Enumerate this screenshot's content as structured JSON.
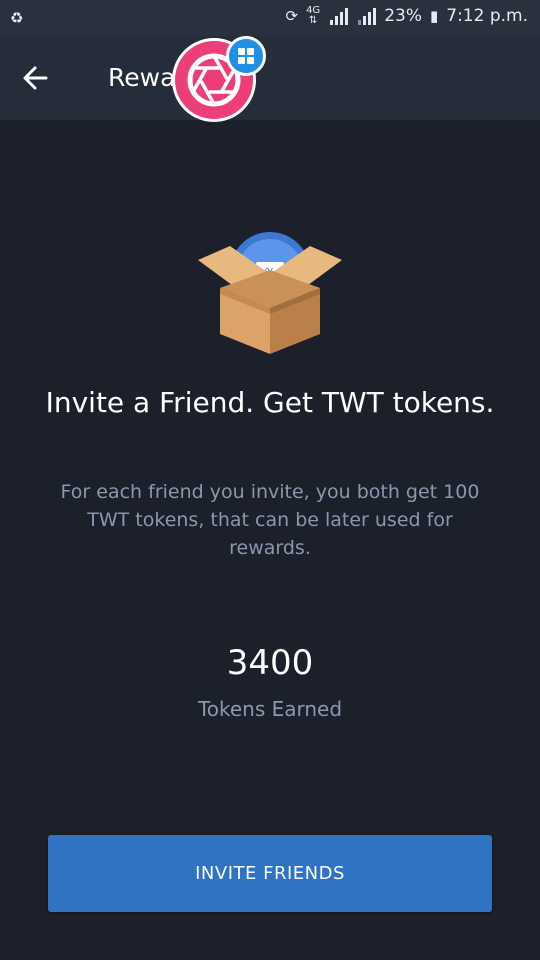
{
  "status_bar": {
    "left_icon": "recycle-icon",
    "network": "4G",
    "battery_percent": "23%",
    "time": "7:12 p.m."
  },
  "app_bar": {
    "back_icon": "arrow-left-icon",
    "title": "Rewa"
  },
  "overlay": {
    "bubble_icon": "camera-aperture-icon",
    "badge_icon": "grid-icon"
  },
  "main": {
    "illustration_icon": "gift-box-coupon-icon",
    "headline": "Invite a Friend. Get TWT tokens.",
    "description": "For each friend you invite, you both get 100 TWT tokens, that can be later used for rewards.",
    "tokens_count": "3400",
    "tokens_label": "Tokens Earned"
  },
  "actions": {
    "invite_label": "INVITE FRIENDS"
  },
  "colors": {
    "background": "#1b202b",
    "app_bar": "#262d3a",
    "button": "#2f73c2",
    "muted_text": "#8b97ad",
    "bubble": "#ec3f79"
  }
}
